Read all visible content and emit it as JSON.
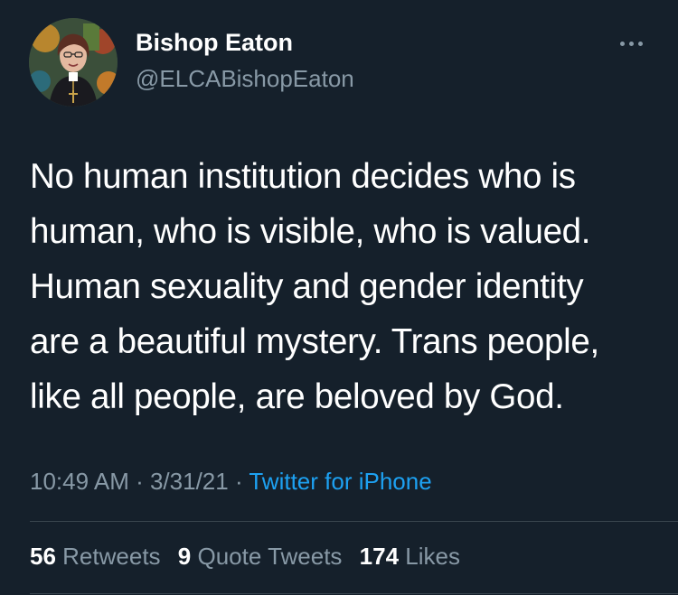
{
  "author": {
    "name": "Bishop Eaton",
    "handle": "@ELCABishopEaton",
    "avatar": "profile-photo"
  },
  "more_icon": "more-horizontal-icon",
  "tweet": {
    "lines": [
      "No human institution decides who is",
      "human, who is visible, who is valued.",
      "Human sexuality and gender identity",
      "are a beautiful mystery. Trans people,",
      "like all people, are beloved by God."
    ]
  },
  "meta": {
    "time": "10:49 AM",
    "sep1": " · ",
    "date": "3/31/21",
    "sep2": " · ",
    "source": "Twitter for iPhone"
  },
  "stats": {
    "retweets_count": "56",
    "retweets_label": "Retweets",
    "quotes_count": "9",
    "quotes_label": "Quote Tweets",
    "likes_count": "174",
    "likes_label": "Likes"
  },
  "colors": {
    "background": "#15202b",
    "text": "#ffffff",
    "secondary": "#8899a6",
    "link": "#1da1f2",
    "divider": "#38444d"
  }
}
